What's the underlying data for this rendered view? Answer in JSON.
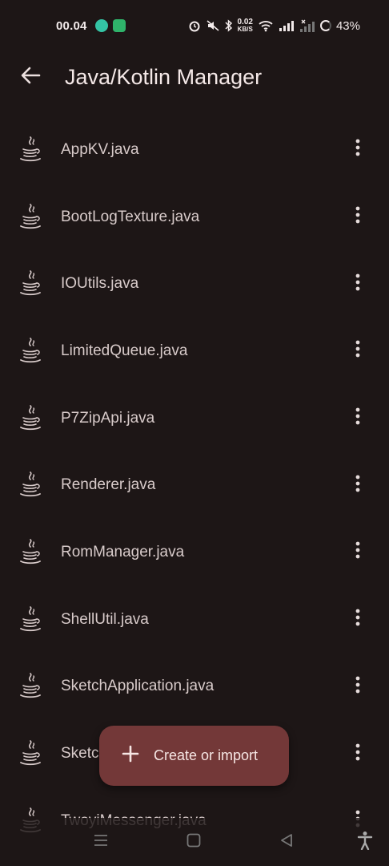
{
  "status_bar": {
    "time": "00.04",
    "net_speed_value": "0.02",
    "net_speed_unit": "KB/S",
    "battery": "43%"
  },
  "app_bar": {
    "title": "Java/Kotlin Manager"
  },
  "files": [
    {
      "name": "AppKV.java"
    },
    {
      "name": "BootLogTexture.java"
    },
    {
      "name": "IOUtils.java"
    },
    {
      "name": "LimitedQueue.java"
    },
    {
      "name": "P7ZipApi.java"
    },
    {
      "name": "Renderer.java"
    },
    {
      "name": "RomManager.java"
    },
    {
      "name": "ShellUtil.java"
    },
    {
      "name": "SketchApplication.java"
    },
    {
      "name": "Sketc"
    },
    {
      "name": "TwoyiMessenger.java"
    }
  ],
  "fab": {
    "label": "Create or import"
  },
  "icons": {
    "back": "arrow-left-icon",
    "file": "java-coffee-cup-icon",
    "more": "more-vert-icon",
    "add": "plus-icon"
  },
  "colors": {
    "background": "#1d1616",
    "fab": "#733838",
    "text": "#ece0df"
  }
}
